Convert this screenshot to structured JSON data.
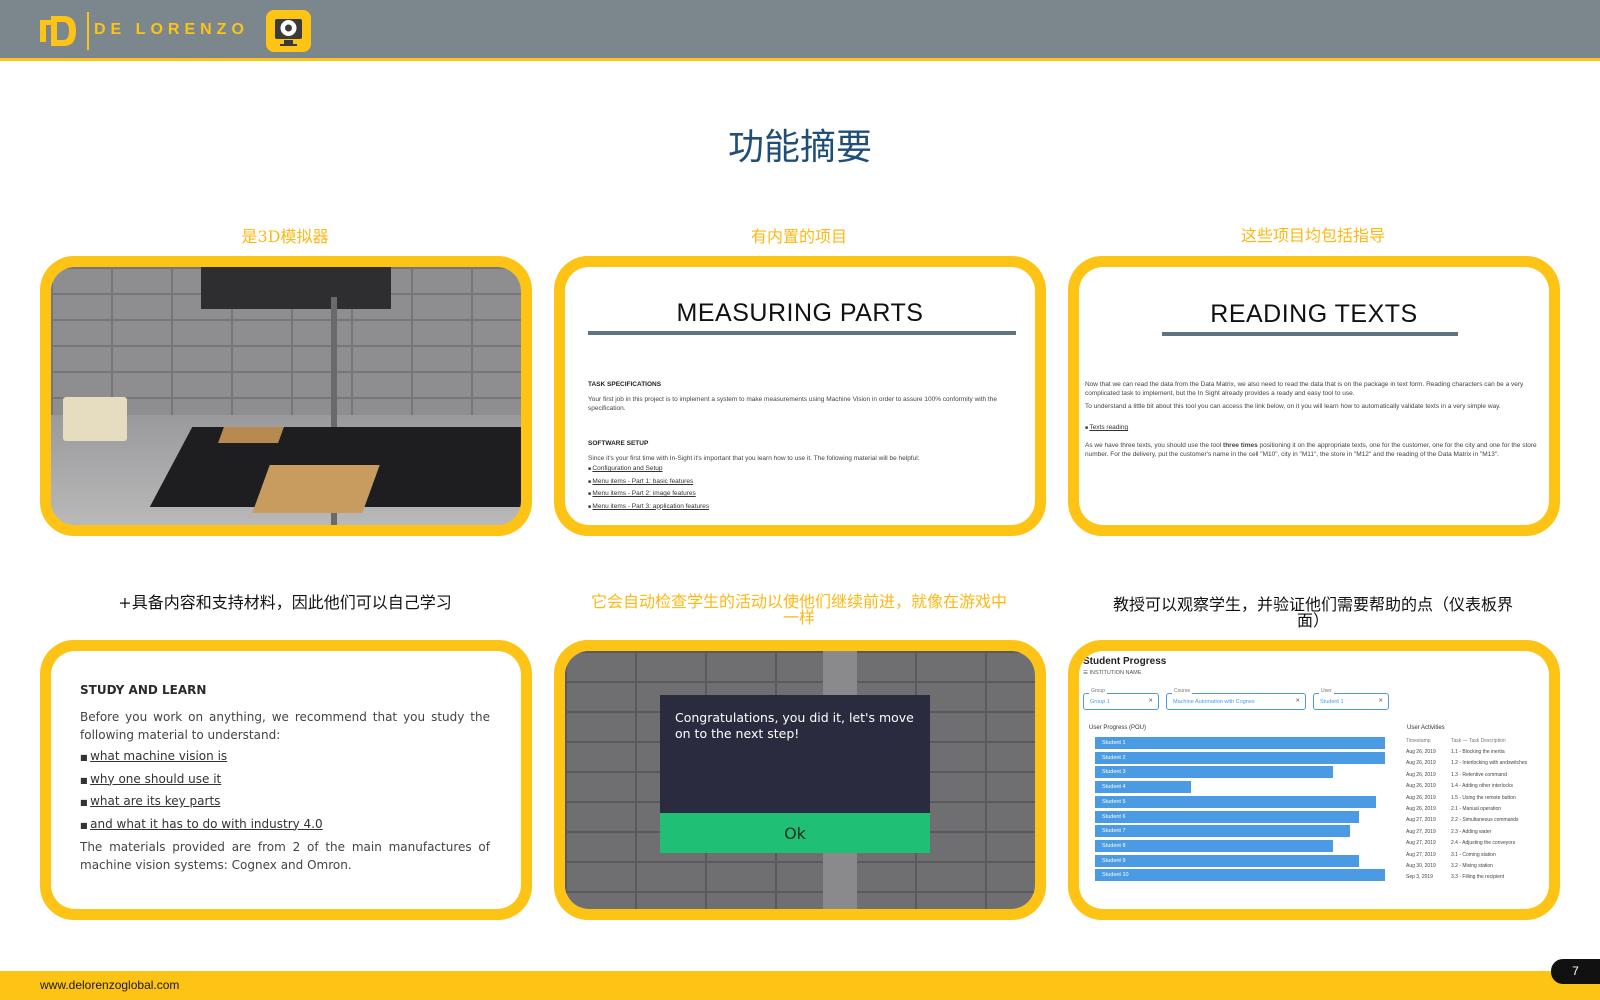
{
  "header": {
    "logo_text": "DE LORENZO"
  },
  "title": "功能摘要",
  "captions": {
    "c1": "是3D模拟器",
    "c2": "有内置的项目",
    "c3": "这些项目均包括指导",
    "c4": "+具备内容和支持材料，因此他们可以自己学习",
    "c5": "它会自动检查学生的活动以使他们继续前进，就像在游戏中一样",
    "c6": "教授可以观察学生，并验证他们需要帮助的点（仪表板界面）"
  },
  "measuring": {
    "heading": "MEASURING PARTS",
    "task_title": "TASK SPECIFICATIONS",
    "task_text": "Your first job in this project is to implement a system to make measurements using Machine Vision in order to assure 100% conformity with the specification.",
    "setup_title": "SOFTWARE SETUP",
    "setup_text": "Since it's your first time with In-Sight it's important that you learn how to use it. The following material will be helpful:",
    "links": [
      "Configuration and Setup",
      "Menu items - Part 1: basic features",
      "Menu items - Part 2: image features",
      "Menu items - Part 3: application features"
    ]
  },
  "reading": {
    "heading": "READING TEXTS",
    "p1": "Now that we can read the data from the Data Matrix, we also need to read the data that is on the package in text form. Reading characters can be a very complicated task to implement, but the In Sight already provides a ready and easy tool to use.",
    "p2": "To understand a little bit about this tool you can access the link below, on it you will learn how to automatically validate texts in a very simple way.",
    "link": "Texts reading",
    "p3a": "As we have three texts, you should use the tool ",
    "p3b": "three times",
    "p3c": " positioning it on the appropriate texts, one for the customer, one for the city and one for the store number. For the delivery, put the customer's name in the cell \"M10\", city in \"M11\", the store in \"M12\" and the reading of the Data Matrix in \"M13\"."
  },
  "study": {
    "title": "STUDY AND LEARN",
    "intro": "Before you work on anything, we recommend that you study the following material to understand:",
    "items": [
      "what machine vision is",
      "why one should use it",
      "what are its key parts",
      "and what it has to do with industry 4.0"
    ],
    "outro": "The materials provided are from 2 of the main manufactures of machine vision systems: Cognex and Omron."
  },
  "congrats": {
    "message": "Congratulations, you did it, let's move on to the next step!",
    "ok_label": "Ok"
  },
  "dashboard": {
    "title": "Student Progress",
    "institution": "☰ INSTITUTION NAME",
    "filters": [
      {
        "label": "Group",
        "value": "Group 1"
      },
      {
        "label": "Course",
        "value": "Machine Automation with Cognex"
      },
      {
        "label": "User",
        "value": "Student 1"
      }
    ],
    "progress_title": "User Progress (POU)",
    "students": [
      {
        "name": "Student 1",
        "progress": 1.0
      },
      {
        "name": "Student 2",
        "progress": 1.0
      },
      {
        "name": "Student 3",
        "progress": 0.82
      },
      {
        "name": "Student 4",
        "progress": 0.33
      },
      {
        "name": "Student 5",
        "progress": 0.97
      },
      {
        "name": "Student 6",
        "progress": 0.91
      },
      {
        "name": "Student 7",
        "progress": 0.88
      },
      {
        "name": "Student 8",
        "progress": 0.82
      },
      {
        "name": "Student 9",
        "progress": 0.91
      },
      {
        "name": "Student 10",
        "progress": 1.0
      }
    ],
    "activities_title": "User Activities",
    "activities_header": {
      "ts": "Timestamp",
      "task": "Task — Task Description"
    },
    "activities": [
      {
        "ts": "Aug 26, 2019",
        "task": "1.1 - Blocking the inertia"
      },
      {
        "ts": "Aug 26, 2019",
        "task": "1.2 - Interlocking with andswitches"
      },
      {
        "ts": "Aug 26, 2019",
        "task": "1.3 - Retentive command"
      },
      {
        "ts": "Aug 26, 2019",
        "task": "1.4 - Adding other interlocks"
      },
      {
        "ts": "Aug 26, 2019",
        "task": "1.5 - Using the remote button"
      },
      {
        "ts": "Aug 26, 2019",
        "task": "2.1 - Manual operation"
      },
      {
        "ts": "Aug 27, 2019",
        "task": "2.2 - Simultaneous commands"
      },
      {
        "ts": "Aug 27, 2019",
        "task": "2.3 - Adding water"
      },
      {
        "ts": "Aug 27, 2019",
        "task": "2.4 - Adjusting the conveyors"
      },
      {
        "ts": "Aug 27, 2019",
        "task": "3.1 - Coming station"
      },
      {
        "ts": "Aug 30, 2019",
        "task": "3.2 - Mixing station"
      },
      {
        "ts": "Sep 3, 2019",
        "task": "3.3 - Filling the recipient"
      }
    ]
  },
  "footer": {
    "url": "www.delorenzoglobal.com",
    "page_number": "7"
  }
}
